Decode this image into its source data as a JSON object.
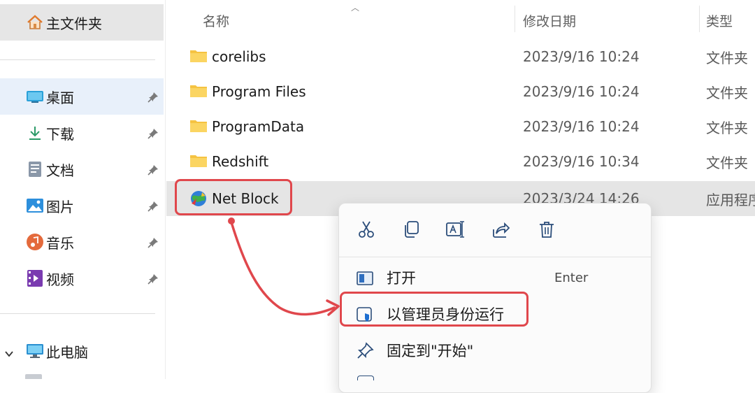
{
  "sidebar": {
    "home": {
      "label": "主文件夹",
      "icon": "home-icon"
    },
    "pinned": [
      {
        "label": "桌面",
        "icon": "desktop-icon",
        "pinned": true
      },
      {
        "label": "下载",
        "icon": "download-icon",
        "pinned": true
      },
      {
        "label": "文档",
        "icon": "document-icon",
        "pinned": true
      },
      {
        "label": "图片",
        "icon": "picture-icon",
        "pinned": true
      },
      {
        "label": "音乐",
        "icon": "music-icon",
        "pinned": true
      },
      {
        "label": "视频",
        "icon": "video-icon",
        "pinned": true
      }
    ],
    "this_pc": {
      "label": "此电脑",
      "icon": "computer-icon",
      "expanded": true
    }
  },
  "columns": {
    "name": "名称",
    "date": "修改日期",
    "type": "类型"
  },
  "files": [
    {
      "name": "corelibs",
      "date": "2023/9/16 10:24",
      "type": "文件夹",
      "icon": "folder-icon"
    },
    {
      "name": "Program Files",
      "date": "2023/9/16 10:24",
      "type": "文件夹",
      "icon": "folder-icon"
    },
    {
      "name": "ProgramData",
      "date": "2023/9/16 10:24",
      "type": "文件夹",
      "icon": "folder-icon"
    },
    {
      "name": "Redshift",
      "date": "2023/9/16 10:34",
      "type": "文件夹",
      "icon": "folder-icon"
    },
    {
      "name": "Net Block",
      "date": "2023/3/24 14:26",
      "type": "应用程序",
      "icon": "app-globe-icon",
      "selected": true
    }
  ],
  "context_menu": {
    "quick_actions": [
      "cut-icon",
      "copy-icon",
      "rename-icon",
      "share-icon",
      "delete-icon"
    ],
    "items": [
      {
        "label": "打开",
        "shortcut": "Enter",
        "icon": "open-icon"
      },
      {
        "label": "以管理员身份运行",
        "shortcut": "",
        "icon": "shield-icon"
      },
      {
        "label": "固定到\"开始\"",
        "shortcut": "",
        "icon": "pin-icon"
      }
    ]
  },
  "colors": {
    "annotation": "#e0474c",
    "folder": "#f5c342",
    "selection": "#e5e5e5",
    "accent": "#0067c0"
  }
}
